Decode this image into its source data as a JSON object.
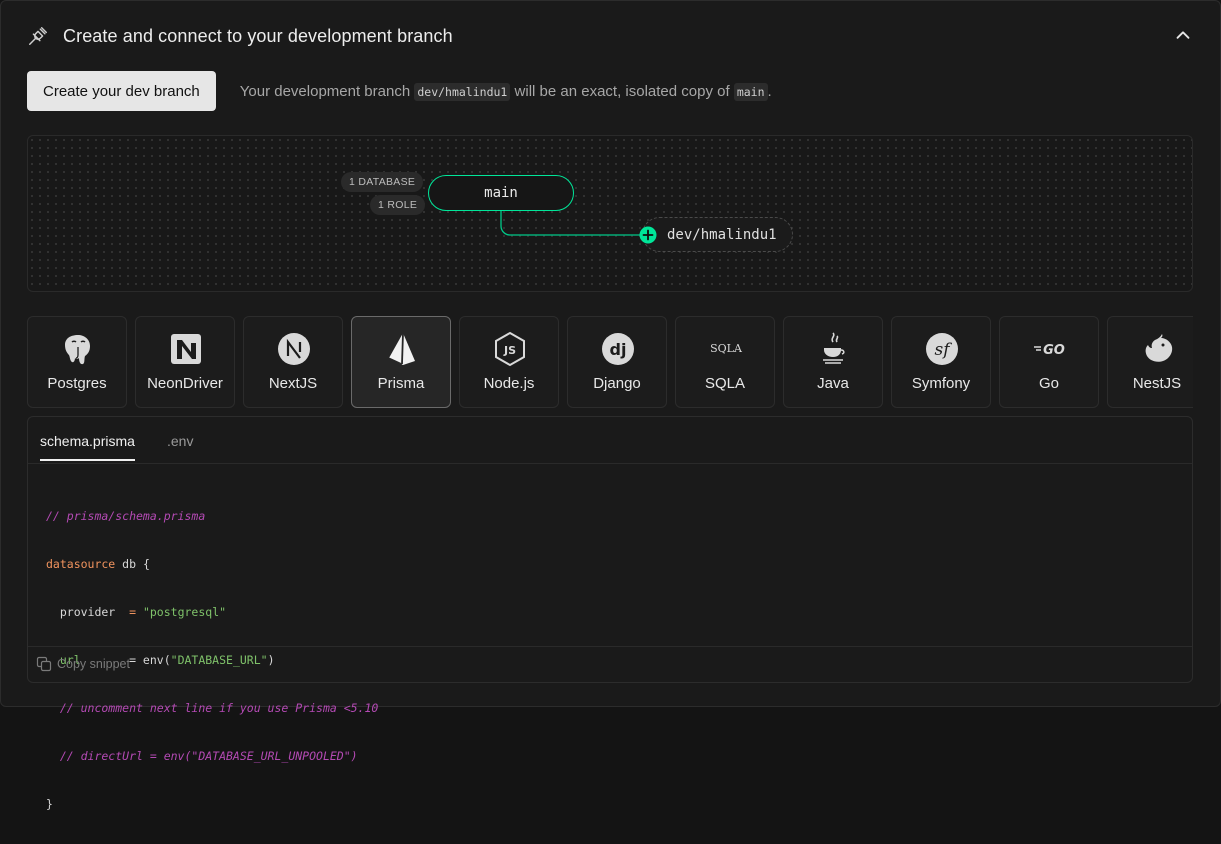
{
  "header": {
    "title": "Create and connect to your development branch",
    "icon": "plug-icon",
    "collapse_icon": "chevron-up-icon"
  },
  "create": {
    "button_label": "Create your dev branch",
    "desc_prefix": "Your development branch",
    "dev_branch": "dev/hmalindu1",
    "desc_middle": "will be an exact, isolated copy of",
    "main_branch": "main",
    "desc_suffix": "."
  },
  "diagram": {
    "tags": [
      "1 DATABASE",
      "1 ROLE"
    ],
    "main_branch": "main",
    "dev_branch": "dev/hmalindu1",
    "accent_color": "#00e699"
  },
  "frameworks": [
    {
      "label": "Postgres",
      "icon": "postgres-elephant-icon",
      "active": false
    },
    {
      "label": "NeonDriver",
      "icon": "neon-logo-icon",
      "active": false
    },
    {
      "label": "NextJS",
      "icon": "nextjs-icon",
      "active": false
    },
    {
      "label": "Prisma",
      "icon": "prisma-icon",
      "active": true
    },
    {
      "label": "Node.js",
      "icon": "nodejs-icon",
      "active": false
    },
    {
      "label": "Django",
      "icon": "django-icon",
      "active": false
    },
    {
      "label": "SQLA",
      "icon": "sqlalchemy-icon",
      "active": false
    },
    {
      "label": "Java",
      "icon": "java-cup-icon",
      "active": false
    },
    {
      "label": "Symfony",
      "icon": "symfony-icon",
      "active": false
    },
    {
      "label": "Go",
      "icon": "go-icon",
      "active": false
    },
    {
      "label": "NestJS",
      "icon": "nestjs-icon",
      "active": false
    }
  ],
  "code": {
    "tabs": [
      {
        "label": "schema.prisma",
        "active": true
      },
      {
        "label": ".env",
        "active": false
      }
    ],
    "lines": {
      "l1": "// prisma/schema.prisma",
      "l2_kw": "datasource",
      "l2_rest": " db {",
      "l3_key": "  provider",
      "l3_eq": "  = ",
      "l3_val": "\"postgresql\"",
      "l4_key": "  url",
      "l4_eq": "       = env(",
      "l4_val": "\"DATABASE_URL\"",
      "l4_end": ")",
      "l5": "  // uncomment next line if you use Prisma <5.10",
      "l6": "  // directUrl = env(\"DATABASE_URL_UNPOOLED\")",
      "l7": "}"
    },
    "copy_label": "Copy snippet",
    "copy_icon": "copy-icon"
  }
}
